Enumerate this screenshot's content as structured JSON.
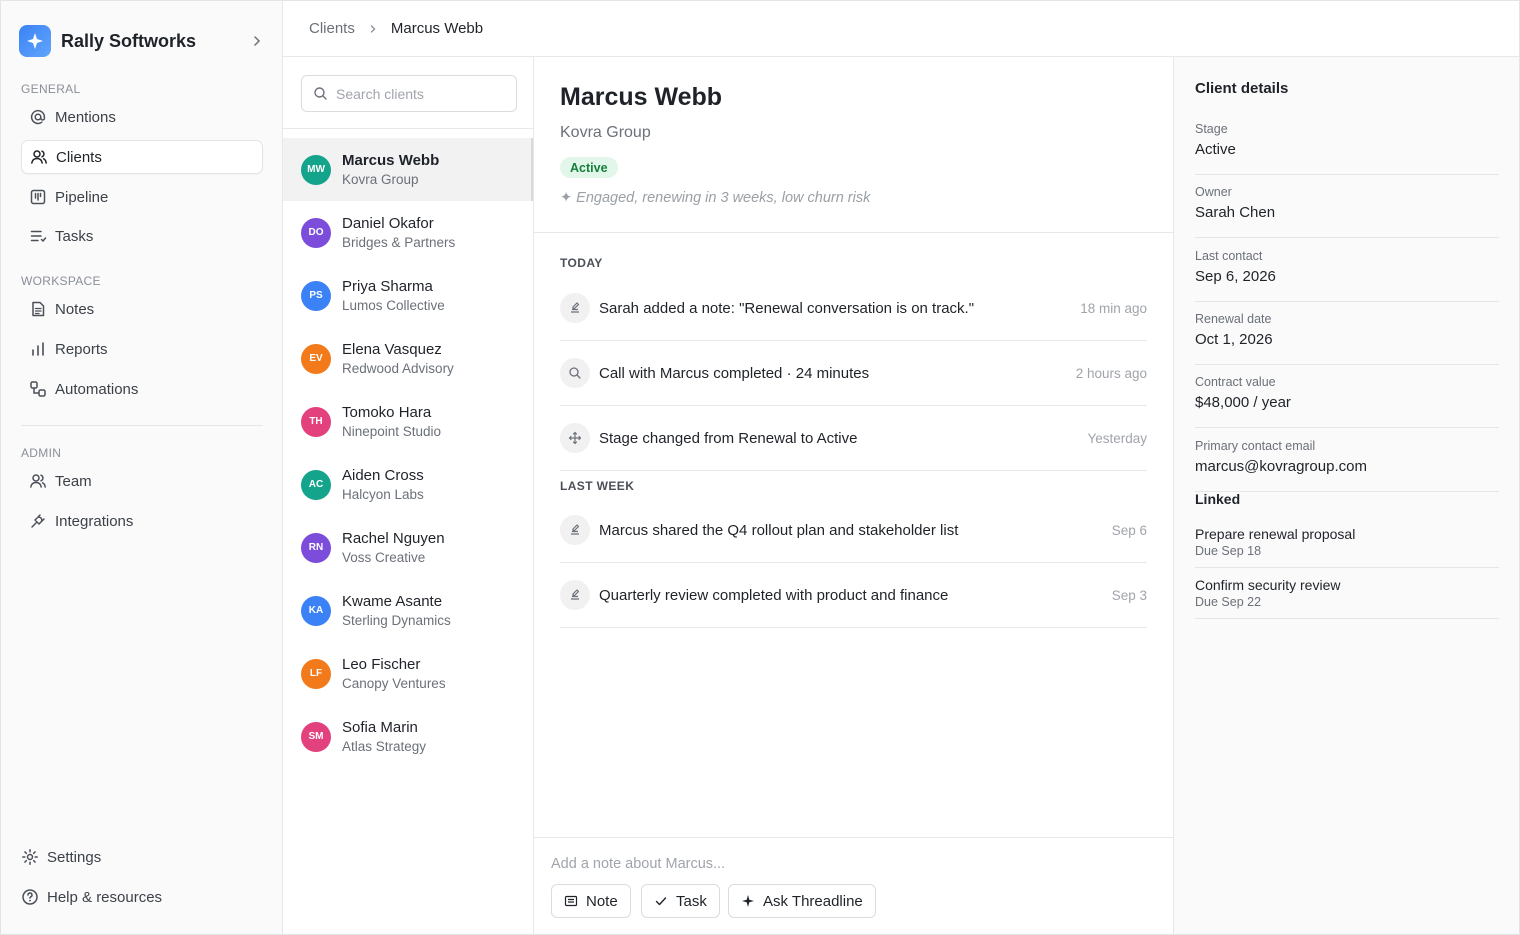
{
  "brand": {
    "name": "Rally Softworks"
  },
  "sidebar": {
    "general_label": "GENERAL",
    "workspace_label": "WORKSPACE",
    "admin_label": "ADMIN",
    "general": [
      {
        "label": "Mentions",
        "icon": "at-icon"
      },
      {
        "label": "Clients",
        "icon": "users-icon",
        "active": true
      },
      {
        "label": "Pipeline",
        "icon": "kanban-icon"
      },
      {
        "label": "Tasks",
        "icon": "list-icon"
      }
    ],
    "workspace": [
      {
        "label": "Notes",
        "icon": "note-icon"
      },
      {
        "label": "Reports",
        "icon": "bar-chart-icon"
      },
      {
        "label": "Automations",
        "icon": "workflow-icon"
      }
    ],
    "admin": [
      {
        "label": "Team",
        "icon": "users-icon"
      },
      {
        "label": "Integrations",
        "icon": "plug-icon"
      }
    ],
    "settings": "Settings",
    "help": "Help & resources"
  },
  "breadcrumb": {
    "root": "Clients",
    "current": "Marcus Webb"
  },
  "search": {
    "placeholder": "Search clients",
    "value": ""
  },
  "clients": [
    {
      "initials": "MW",
      "name": "Marcus Webb",
      "company": "Kovra Group",
      "color": "#14a38b"
    },
    {
      "initials": "DO",
      "name": "Daniel Okafor",
      "company": "Bridges & Partners",
      "color": "#7c4ddb"
    },
    {
      "initials": "PS",
      "name": "Priya Sharma",
      "company": "Lumos Collective",
      "color": "#3b82f6"
    },
    {
      "initials": "EV",
      "name": "Elena Vasquez",
      "company": "Redwood Advisory",
      "color": "#f27a1a"
    },
    {
      "initials": "TH",
      "name": "Tomoko Hara",
      "company": "Ninepoint Studio",
      "color": "#e3417d"
    },
    {
      "initials": "AC",
      "name": "Aiden Cross",
      "company": "Halcyon Labs",
      "color": "#14a38b"
    },
    {
      "initials": "RN",
      "name": "Rachel Nguyen",
      "company": "Voss Creative",
      "color": "#7c4ddb"
    },
    {
      "initials": "KA",
      "name": "Kwame Asante",
      "company": "Sterling Dynamics",
      "color": "#3b82f6"
    },
    {
      "initials": "LF",
      "name": "Leo Fischer",
      "company": "Canopy Ventures",
      "color": "#f27a1a"
    },
    {
      "initials": "SM",
      "name": "Sofia Marin",
      "company": "Atlas Strategy",
      "color": "#e3417d"
    }
  ],
  "main": {
    "name": "Marcus Webb",
    "company": "Kovra Group",
    "status": "Active",
    "summary": "✦ Engaged, renewing in 3 weeks, low churn risk",
    "today_label": "TODAY",
    "last_week_label": "LAST WEEK",
    "today": [
      {
        "icon": "note-icon",
        "text": "Sarah added a note: \"Renewal conversation is on track.\"",
        "time": "18 min ago"
      },
      {
        "icon": "call-icon",
        "text": "Call with Marcus completed · 24 minutes",
        "time": "2 hours ago"
      },
      {
        "icon": "move-icon",
        "text": "Stage changed from Renewal to Active",
        "time": "Yesterday"
      }
    ],
    "last_week": [
      {
        "icon": "note-icon",
        "text": "Marcus shared the Q4 rollout plan and stakeholder list",
        "time": "Sep 6"
      },
      {
        "icon": "note-icon",
        "text": "Quarterly review completed with product and finance",
        "time": "Sep 3"
      }
    ],
    "composer_placeholder": "Add a note about Marcus...",
    "buttons": {
      "note": "Note",
      "task": "Task",
      "ask": "Ask Threadline"
    }
  },
  "details": {
    "title": "Client details",
    "fields": [
      {
        "label": "Stage",
        "value": "Active"
      },
      {
        "label": "Owner",
        "value": "Sarah Chen"
      },
      {
        "label": "Last contact",
        "value": "Sep 6, 2026"
      },
      {
        "label": "Renewal date",
        "value": "Oct 1, 2026"
      },
      {
        "label": "Contract value",
        "value": "$48,000 / year"
      },
      {
        "label": "Primary contact email",
        "value": "marcus@kovragroup.com"
      }
    ],
    "linked_title": "Linked",
    "linked": [
      {
        "name": "Prepare renewal proposal",
        "due": "Due Sep 18"
      },
      {
        "name": "Confirm security review",
        "due": "Due Sep 22"
      }
    ]
  }
}
